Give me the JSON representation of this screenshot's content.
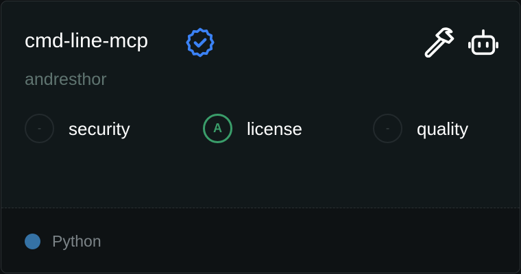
{
  "server": {
    "name": "cmd-line-mcp",
    "author": "andresthor"
  },
  "badges": {
    "verified_icon": "verified-badge-icon",
    "tools_icon": "hammer-icon",
    "agent_icon": "robot-icon"
  },
  "scores": [
    {
      "grade": "-",
      "label": "security"
    },
    {
      "grade": "A",
      "label": "license"
    },
    {
      "grade": "-",
      "label": "quality"
    }
  ],
  "language": {
    "name": "Python",
    "color": "#3572a5"
  },
  "colors": {
    "verified": "#3b82f6",
    "grade_a": "#3a9d6a"
  }
}
